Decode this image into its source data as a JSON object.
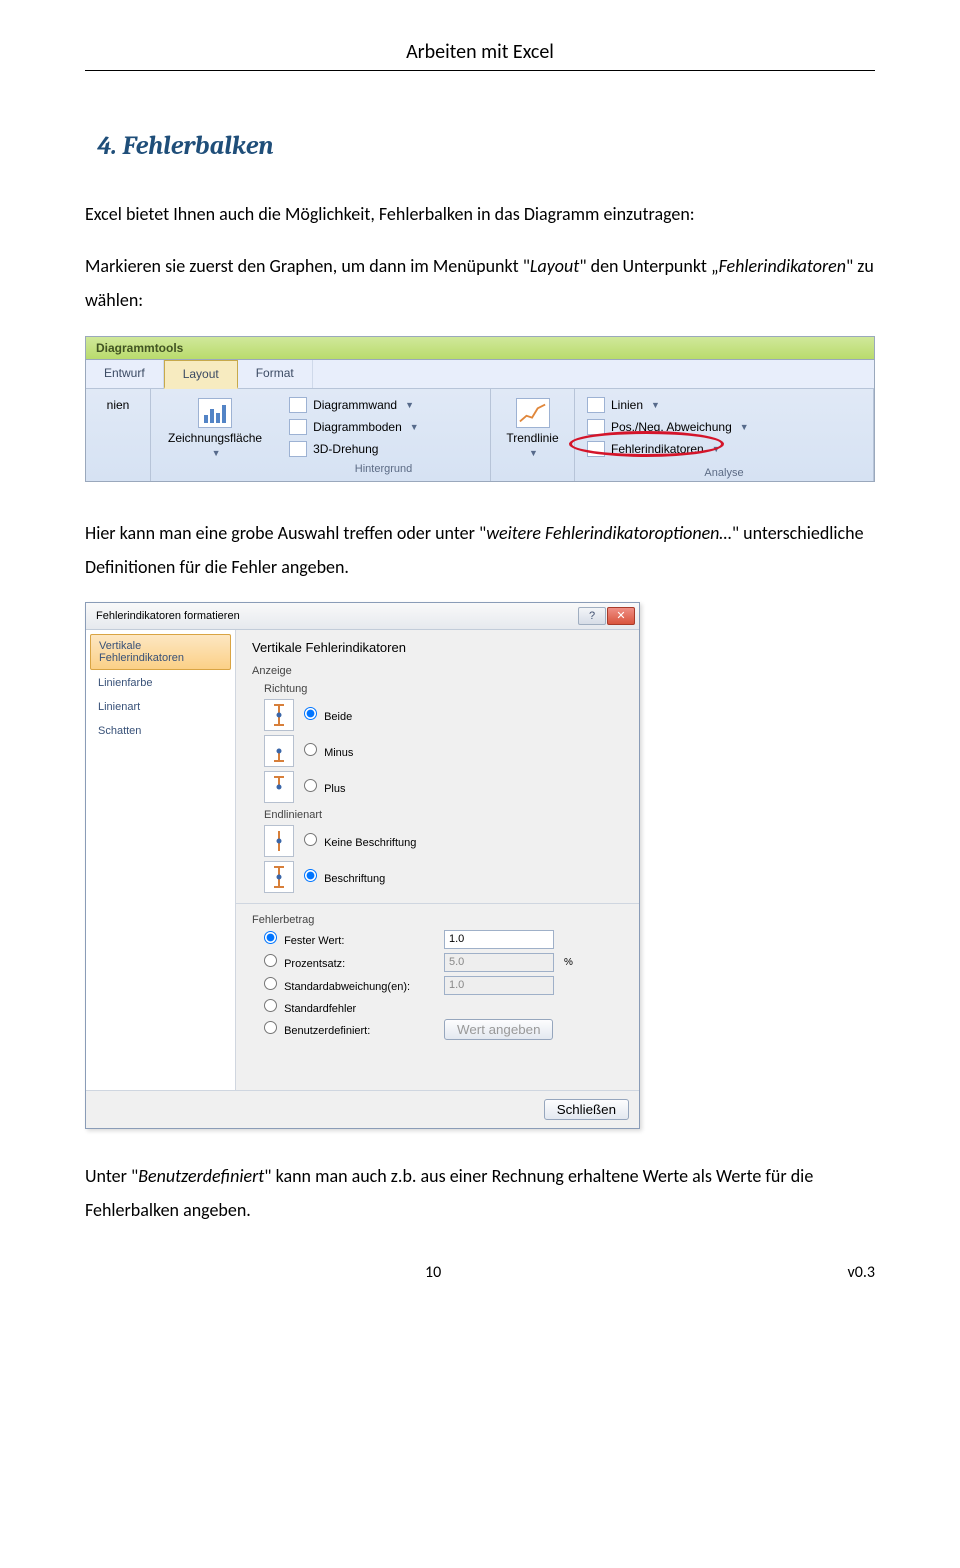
{
  "doc_header": "Arbeiten mit Excel",
  "section_title": "4. Fehlerbalken",
  "para1": "Excel bietet Ihnen auch die Möglichkeit, Fehlerbalken in das Diagramm einzutragen:",
  "para2_pre": "Markieren sie zuerst den Graphen, um dann im Menüpunkt \"",
  "para2_i1": "Layout",
  "para2_mid": "\" den Unterpunkt „",
  "para2_i2": "Fehlerindikatoren",
  "para2_post": "\" zu wählen:",
  "ribbon": {
    "title": "Diagrammtools",
    "tabs": [
      "Entwurf",
      "Layout",
      "Format"
    ],
    "active_tab": "Layout",
    "group1": {
      "label1": "nien",
      "btn": "Zeichnungsfläche"
    },
    "group2": {
      "items": [
        "Diagrammwand",
        "Diagrammboden",
        "3D-Drehung"
      ],
      "caption": "Hintergrund"
    },
    "group3": {
      "btn": "Trendlinie"
    },
    "group4": {
      "items": [
        "Linien",
        "Pos./Neg. Abweichung",
        "Fehlerindikatoren"
      ],
      "caption": "Analyse"
    }
  },
  "para3_pre": "Hier kann man eine grobe Auswahl treffen oder unter \"",
  "para3_i": "weitere Fehlerindikatoroptionen…",
  "para3_post": "\" unterschiedliche Definitionen für die Fehler angeben.",
  "dialog": {
    "title": "Fehlerindikatoren formatieren",
    "nav": [
      "Vertikale Fehlerindikatoren",
      "Linienfarbe",
      "Linienart",
      "Schatten"
    ],
    "heading": "Vertikale Fehlerindikatoren",
    "sec_anzeige": "Anzeige",
    "sec_richtung": "Richtung",
    "richtung_opts": [
      "Beide",
      "Minus",
      "Plus"
    ],
    "sec_endlinie": "Endlinienart",
    "endlinie_opts": [
      "Keine Beschriftung",
      "Beschriftung"
    ],
    "fehlerbetrag": "Fehlerbetrag",
    "fb_opts": [
      {
        "label": "Fester Wert:",
        "val": "1.0",
        "enabled": true
      },
      {
        "label": "Prozentsatz:",
        "val": "5.0",
        "suffix": "%",
        "enabled": false
      },
      {
        "label": "Standardabweichung(en):",
        "val": "1.0",
        "enabled": false
      },
      {
        "label": "Standardfehler",
        "val": "",
        "enabled": false
      },
      {
        "label": "Benutzerdefiniert:",
        "btn": "Wert angeben",
        "enabled": false
      }
    ],
    "close_btn": "Schließen"
  },
  "para4_pre": "Unter \"",
  "para4_i": "Benutzerdefiniert",
  "para4_post": "\" kann man auch z.b. aus einer Rechnung erhaltene Werte als Werte für die Fehlerbalken angeben.",
  "footer": {
    "page": "10",
    "version": "v0.3"
  }
}
